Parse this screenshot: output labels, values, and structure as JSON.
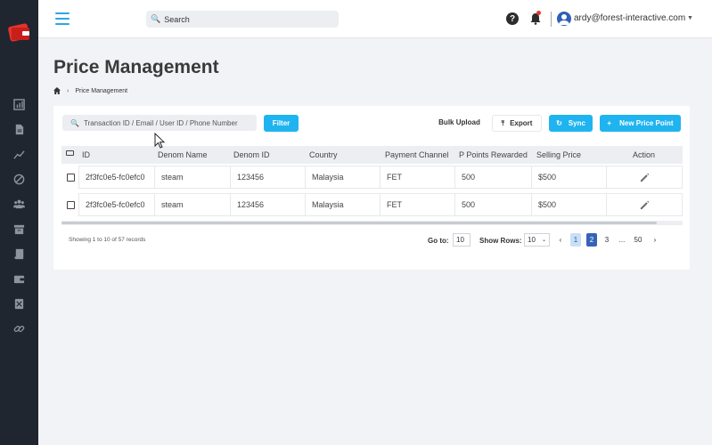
{
  "header": {
    "search_placeholder": "Search",
    "user_email": "ardy@forest-interactive.com"
  },
  "page": {
    "title": "Price Management",
    "breadcrumb": [
      "Price Management"
    ]
  },
  "toolbar": {
    "filter_placeholder": "Transaction ID / Email / User ID / Phone Number",
    "filter_label": "Filter",
    "bulk_upload_label": "Bulk Upload",
    "export_label": "Export",
    "sync_label": "Sync",
    "new_price_point_label": "New Price Point"
  },
  "table": {
    "columns": [
      "ID",
      "Denom Name",
      "Denom ID",
      "Country",
      "Payment Channel",
      "P Points Rewarded",
      "Selling Price",
      "Action"
    ],
    "rows": [
      {
        "id": "2f3fc0e5-fc0efc0",
        "denom_name": "steam",
        "denom_id": "123456",
        "country": "Malaysia",
        "payment_channel": "FET",
        "points": "500",
        "price": "$500"
      },
      {
        "id": "2f3fc0e5-fc0efc0",
        "denom_name": "steam",
        "denom_id": "123456",
        "country": "Malaysia",
        "payment_channel": "FET",
        "points": "500",
        "price": "$500"
      }
    ]
  },
  "pagination": {
    "summary": "Showing 1 to 10 of 57 records",
    "goto_label": "Go to:",
    "goto_value": "10",
    "show_rows_label": "Show Rows:",
    "show_rows_value": "10",
    "prev": "‹",
    "pages": [
      "1",
      "2",
      "3",
      "...",
      "50"
    ],
    "next": "›"
  },
  "colors": {
    "accent": "#1fb4f0",
    "sidebar": "#1f2630",
    "active_page": "#3563b8",
    "logo_red": "#e5322d"
  }
}
